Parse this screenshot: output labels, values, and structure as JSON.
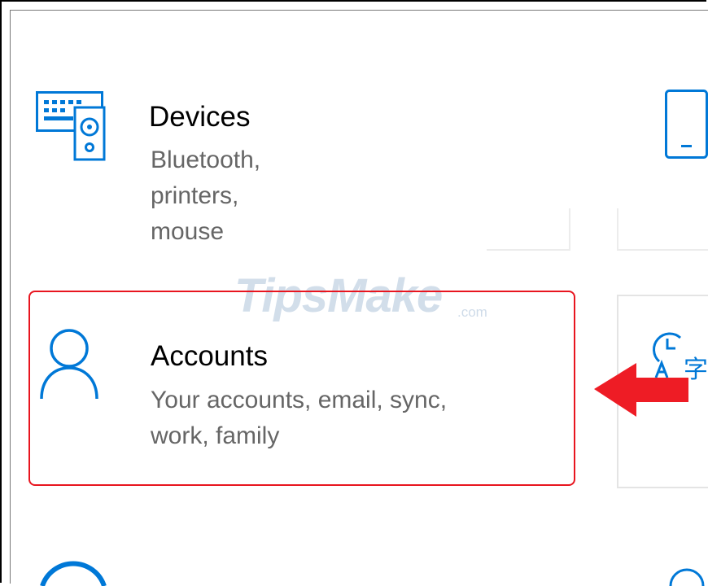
{
  "tiles": {
    "devices": {
      "title": "Devices",
      "description": "Bluetooth, printers, mouse"
    },
    "accounts": {
      "title": "Accounts",
      "description_line1": "Your accounts, email, sync,",
      "description_line2": "work, family"
    }
  },
  "partial_tile_glyph": "字",
  "watermark": {
    "text": "TipsMake",
    "suffix": ".com"
  },
  "colors": {
    "icon": "#0078d7",
    "highlight": "#e8151f",
    "arrow": "#ee1c25"
  },
  "icons": [
    "devices-icon",
    "phone-icon",
    "account-icon",
    "time-language-icon",
    "pointer-arrow"
  ]
}
